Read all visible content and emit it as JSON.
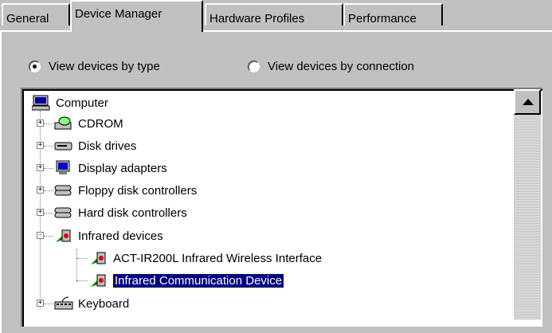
{
  "tabs": [
    {
      "label": "General",
      "active": false
    },
    {
      "label": "Device Manager",
      "active": true
    },
    {
      "label": "Hardware Profiles",
      "active": false
    },
    {
      "label": "Performance",
      "active": false
    }
  ],
  "view_options": {
    "by_type": {
      "label": "View devices by type",
      "selected": true
    },
    "by_connection": {
      "label": "View devices by connection",
      "selected": false
    }
  },
  "tree": {
    "root": {
      "label": "Computer",
      "icon": "computer-icon"
    },
    "items": [
      {
        "label": "CDROM",
        "icon": "cdrom-icon",
        "expander": "+"
      },
      {
        "label": "Disk drives",
        "icon": "disk-drive-icon",
        "expander": "+"
      },
      {
        "label": "Display adapters",
        "icon": "monitor-icon",
        "expander": "+"
      },
      {
        "label": "Floppy disk controllers",
        "icon": "controller-icon",
        "expander": "+"
      },
      {
        "label": "Hard disk controllers",
        "icon": "controller-icon",
        "expander": "+"
      },
      {
        "label": "Infrared devices",
        "icon": "infrared-icon",
        "expander": "-",
        "children": [
          {
            "label": "ACT-IR200L Infrared Wireless Interface",
            "icon": "infrared-icon",
            "selected": false
          },
          {
            "label": "Infrared Communication Device",
            "icon": "infrared-icon",
            "selected": true
          }
        ]
      },
      {
        "label": "Keyboard",
        "icon": "keyboard-icon",
        "expander": "+"
      }
    ]
  },
  "colors": {
    "face": "#c0c0c0",
    "selection": "#000080"
  }
}
